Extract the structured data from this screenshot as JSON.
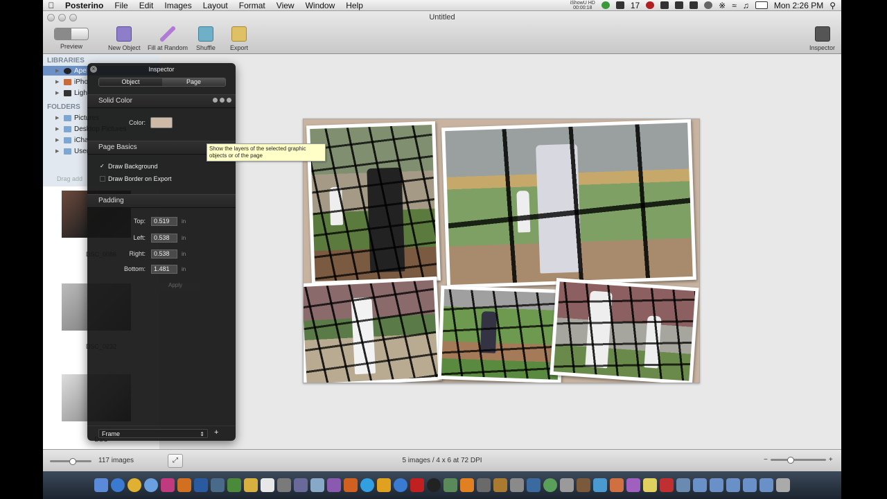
{
  "menubar": {
    "app": "Posterino",
    "items": [
      "File",
      "Edit",
      "Images",
      "Layout",
      "Format",
      "View",
      "Window",
      "Help"
    ],
    "ishowu": "iShowU HD",
    "ishowu_time": "00:00:18",
    "badge_count": "17",
    "clock": "Mon 2:26 PM"
  },
  "window": {
    "title": "Untitled"
  },
  "toolbar": {
    "preview": "Preview",
    "new_object": "New Object",
    "fill_random": "Fill at Random",
    "shuffle": "Shuffle",
    "export": "Export",
    "inspector": "Inspector"
  },
  "sidebar": {
    "libraries_header": "LIBRARIES",
    "libraries": [
      "Ape",
      "iPho",
      "Ligh"
    ],
    "folders_header": "FOLDERS",
    "folders": [
      "Pictures",
      "Desktop Pictures",
      "iCha",
      "User"
    ],
    "drag_hint": "Drag add",
    "thumb_labels": [
      "DSC_0086",
      "DSC_0232",
      "DSC"
    ]
  },
  "inspector": {
    "title": "Inspector",
    "tabs": [
      "Object",
      "Page"
    ],
    "solid_color": "Solid Color",
    "color_label": "Color:",
    "page_basics": "Page Basics",
    "draw_background": "Draw Background",
    "draw_border": "Draw Border on Export",
    "padding": "Padding",
    "top_label": "Top:",
    "top_value": "0.519",
    "left_label": "Left:",
    "left_value": "0.538",
    "right_label": "Right:",
    "right_value": "0.538",
    "bottom_label": "Bottom:",
    "bottom_value": "1.481",
    "unit": "in",
    "apply": "Apply",
    "frame": "Frame",
    "add": "+"
  },
  "tooltip": "Show the layers of the selected graphic objects or of the page",
  "status": {
    "image_count": "117 images",
    "page_info": "5 images / 4 x 6 at 72 DPI"
  },
  "colors": {
    "page_background": "#cdb9a6",
    "selection": "#6b8fc7"
  }
}
